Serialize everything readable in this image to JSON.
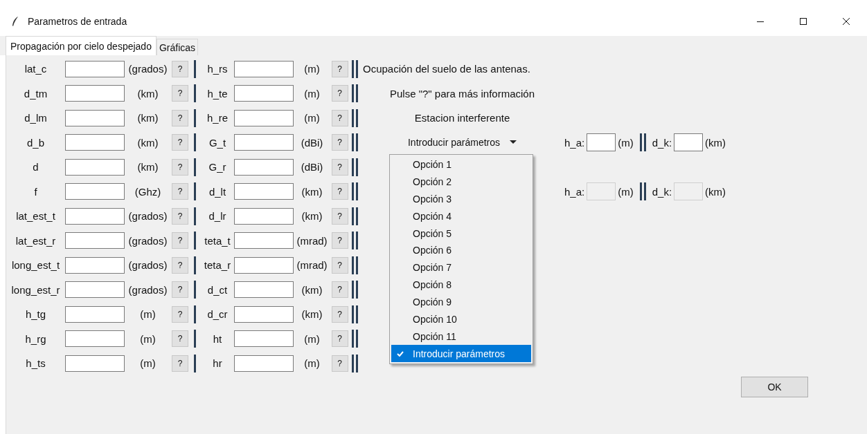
{
  "window": {
    "title": "Parametros de entrada"
  },
  "tabs": [
    {
      "label": "Propagación por cielo despejado",
      "selected": true
    },
    {
      "label": "Gráficas",
      "selected": false
    }
  ],
  "rows": [
    {
      "left": {
        "label": "lat_c",
        "unit": "(grados)",
        "help": "?"
      },
      "right": {
        "label": "h_rs",
        "unit": "(m)",
        "help": "?"
      }
    },
    {
      "left": {
        "label": "d_tm",
        "unit": "(km)",
        "help": "?"
      },
      "right": {
        "label": "h_te",
        "unit": "(m)",
        "help": "?"
      }
    },
    {
      "left": {
        "label": "d_lm",
        "unit": "(km)",
        "help": "?"
      },
      "right": {
        "label": "h_re",
        "unit": "(m)",
        "help": "?"
      }
    },
    {
      "left": {
        "label": "d_b",
        "unit": "(km)",
        "help": "?"
      },
      "right": {
        "label": "G_t",
        "unit": "(dBi)",
        "help": "?"
      }
    },
    {
      "left": {
        "label": "d",
        "unit": "(km)",
        "help": "?"
      },
      "right": {
        "label": "G_r",
        "unit": "(dBi)",
        "help": "?"
      }
    },
    {
      "left": {
        "label": "f",
        "unit": "(Ghz)",
        "help": "?"
      },
      "right": {
        "label": "d_lt",
        "unit": "(km)",
        "help": "?"
      }
    },
    {
      "left": {
        "label": "lat_est_t",
        "unit": "(grados)",
        "help": "?"
      },
      "right": {
        "label": "d_lr",
        "unit": "(km)",
        "help": "?"
      }
    },
    {
      "left": {
        "label": "lat_est_r",
        "unit": "(grados)",
        "help": "?"
      },
      "right": {
        "label": "teta_t",
        "unit": "(mrad)",
        "help": "?"
      }
    },
    {
      "left": {
        "label": "long_est_t",
        "unit": "(grados)",
        "help": "?"
      },
      "right": {
        "label": "teta_r",
        "unit": "(mrad)",
        "help": "?"
      }
    },
    {
      "left": {
        "label": "long_est_r",
        "unit": "(grados)",
        "help": "?"
      },
      "right": {
        "label": "d_ct",
        "unit": "(km)",
        "help": "?"
      }
    },
    {
      "left": {
        "label": "h_tg",
        "unit": "(m)",
        "help": "?"
      },
      "right": {
        "label": "d_cr",
        "unit": "(km)",
        "help": "?"
      }
    },
    {
      "left": {
        "label": "h_rg",
        "unit": "(m)",
        "help": "?"
      },
      "right": {
        "label": "ht",
        "unit": "(m)",
        "help": "?"
      }
    },
    {
      "left": {
        "label": "h_ts",
        "unit": "(m)",
        "help": "?"
      },
      "right": {
        "label": "hr",
        "unit": "(m)",
        "help": "?"
      }
    }
  ],
  "info": [
    "Ocupación del suelo de las antenas.",
    "Pulse \"?\" para más información",
    "Estacion interferente"
  ],
  "station_select": {
    "value": "Introducir parámetros",
    "expanded": true,
    "options": [
      {
        "label": "Opción 1",
        "selected": false
      },
      {
        "label": "Opción 2",
        "selected": false
      },
      {
        "label": "Opción 3",
        "selected": false
      },
      {
        "label": "Opción 4",
        "selected": false
      },
      {
        "label": "Opción 5",
        "selected": false
      },
      {
        "label": "Opción 6",
        "selected": false
      },
      {
        "label": "Opción 7",
        "selected": false
      },
      {
        "label": "Opción 8",
        "selected": false
      },
      {
        "label": "Opción 9",
        "selected": false
      },
      {
        "label": "Opción 10",
        "selected": false
      },
      {
        "label": "Opción 11",
        "selected": false
      },
      {
        "label": "Introducir parámetros",
        "selected": true
      }
    ]
  },
  "station_fields": [
    {
      "disabled": false,
      "a_label": "h_a:",
      "a_unit": "(m)",
      "k_label": "d_k:",
      "k_unit": "(km)"
    },
    {
      "disabled": true,
      "a_label": "h_a:",
      "a_unit": "(m)",
      "k_label": "d_k:",
      "k_unit": "(km)"
    }
  ],
  "ok_button": "OK"
}
